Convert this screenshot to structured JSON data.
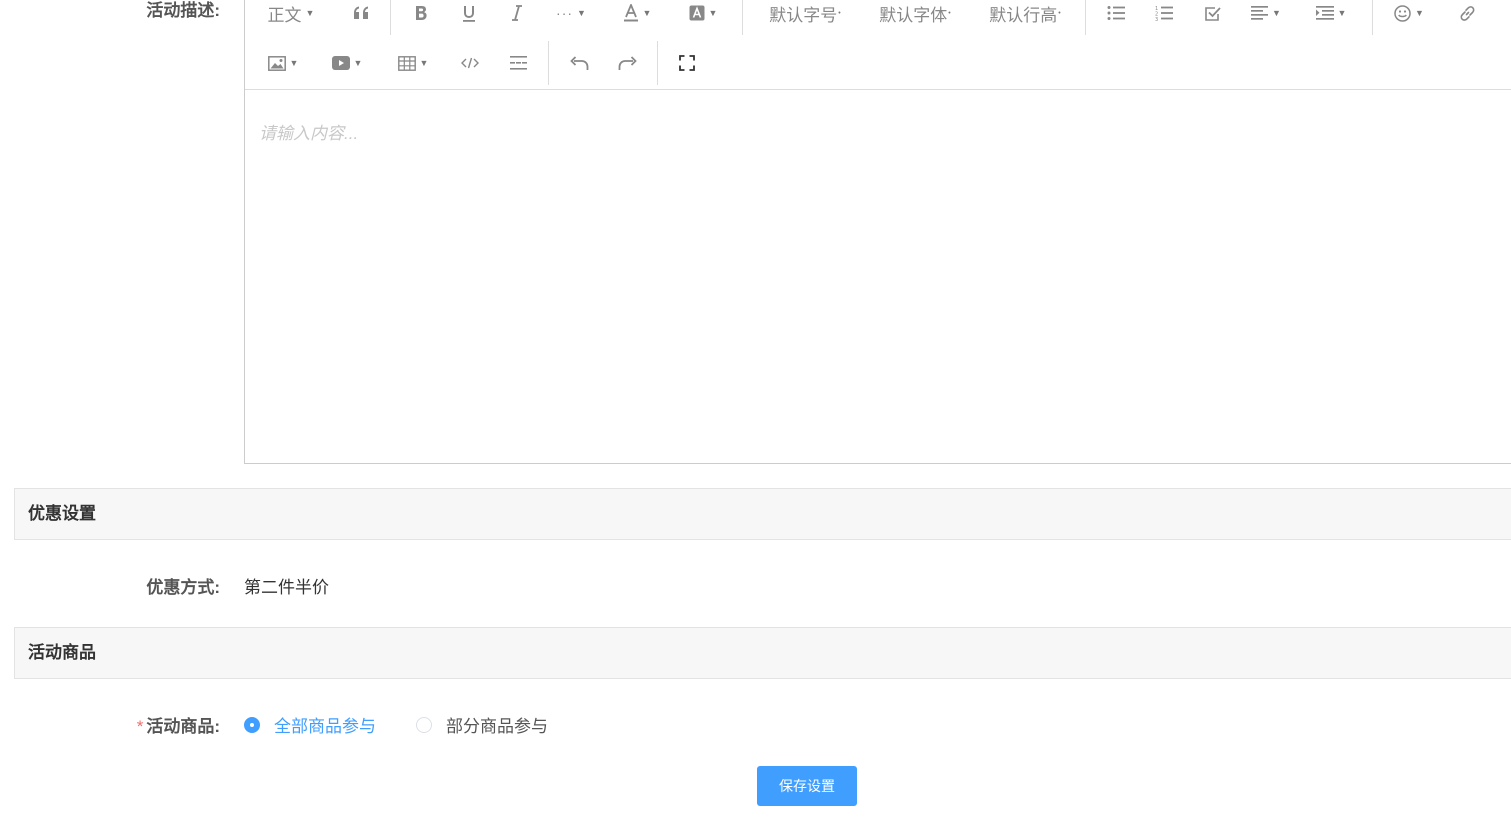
{
  "description": {
    "label": "活动描述:",
    "toolbar": {
      "heading": "正文",
      "font_size": "默认字号",
      "font_family": "默认字体",
      "line_height": "默认行高"
    },
    "placeholder": "请输入内容..."
  },
  "discount_section": {
    "title": "优惠设置",
    "method_label": "优惠方式:",
    "method_value": "第二件半价"
  },
  "goods_section": {
    "title": "活动商品",
    "goods_label": "活动商品:",
    "options": [
      "全部商品参与",
      "部分商品参与"
    ],
    "selected_index": 0
  },
  "save_button": "保存设置",
  "colors": {
    "primary": "#409eff",
    "required": "#f56c6c",
    "section_bg": "#f7f7f7"
  }
}
